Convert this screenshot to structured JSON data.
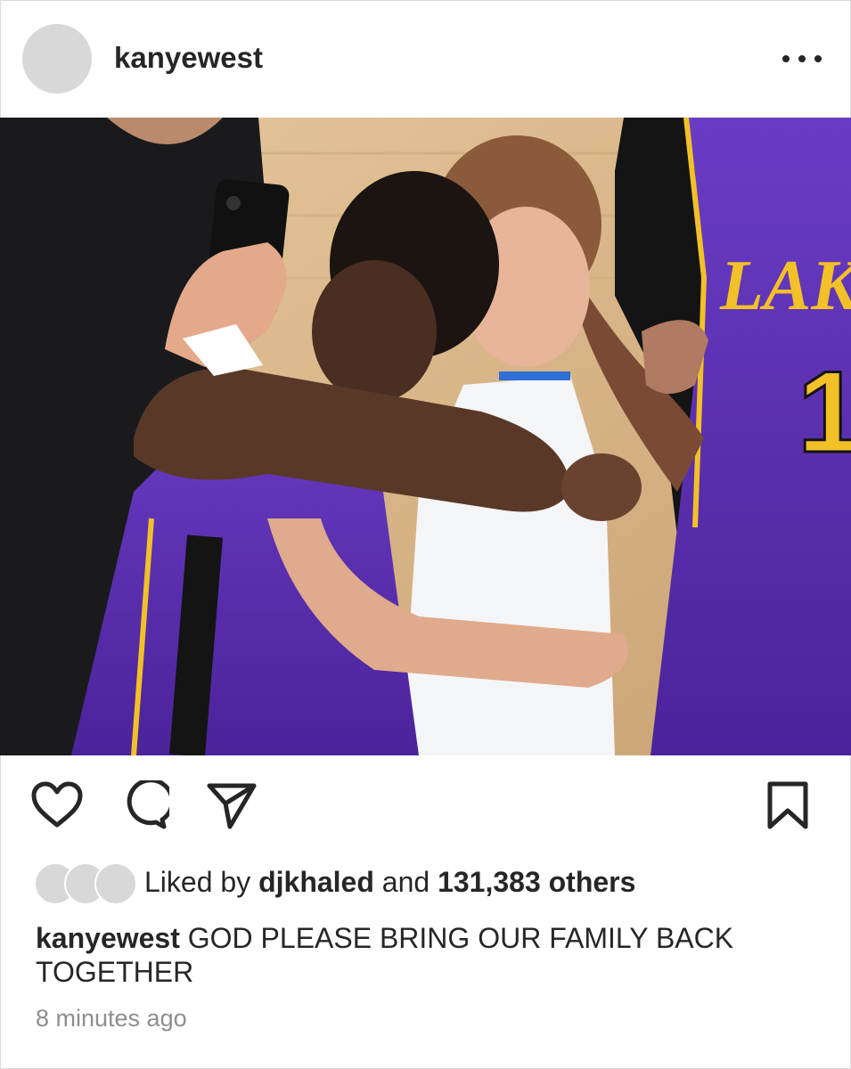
{
  "post": {
    "username": "kanyewest",
    "more_icon": "more-horizontal-icon",
    "photo_text": {
      "jersey_text": "LAK",
      "jersey_number": "1"
    },
    "actions": {
      "like_icon": "heart-icon",
      "comment_icon": "comment-icon",
      "share_icon": "send-icon",
      "save_icon": "bookmark-icon"
    },
    "likes": {
      "prefix": "Liked by ",
      "user": "djkhaled",
      "middle": " and ",
      "count": "131,383 others"
    },
    "caption": {
      "user": "kanyewest",
      "text": " GOD PLEASE BRING OUR FAMILY BACK TOGETHER"
    },
    "timestamp": "8 minutes ago"
  },
  "colors": {
    "lakers_purple": "#5a2ea8",
    "lakers_gold": "#f2c027",
    "mavs_white": "#f4f5f7",
    "court": "#d9b88c"
  }
}
